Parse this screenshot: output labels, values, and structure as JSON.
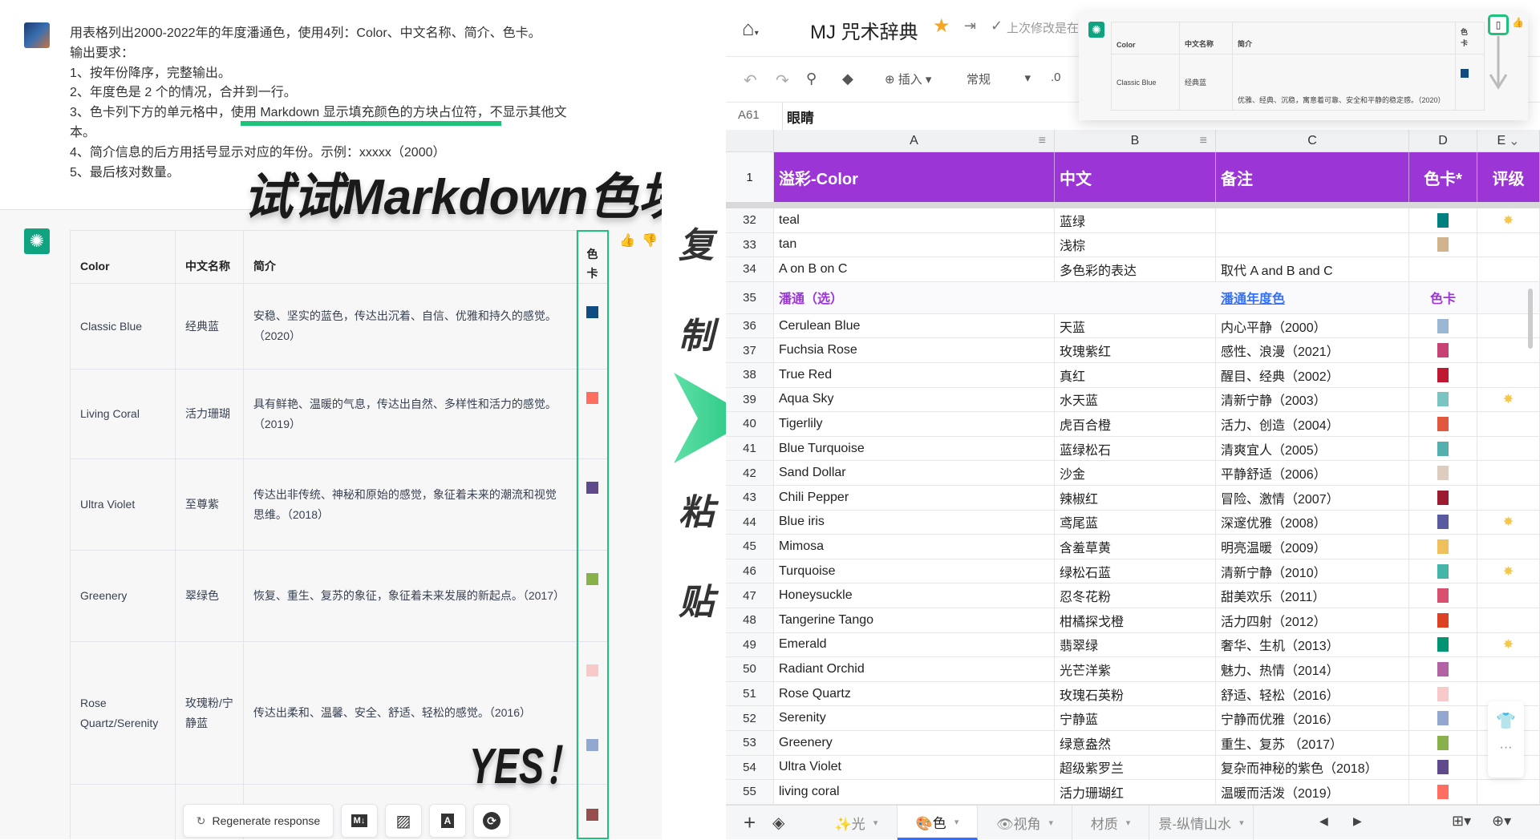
{
  "prompt": {
    "lines": [
      "用表格列出2000-2022年的年度潘通色，使用4列：Color、中文名称、简介、色卡。",
      "输出要求：",
      "1、按年份降序，完整输出。",
      "2、年度色是 2 个的情况，合并到一行。",
      "3、色卡列下方的单元格中，使用 Markdown 显示填充颜色的方块占位符，不显示其他文",
      "本。",
      "4、简介信息的后方用括号显示对应的年份。示例：xxxxx（2000）",
      "5、最后核对数量。"
    ]
  },
  "captions": {
    "title": "试试Markdown色块",
    "yes": "YES！",
    "vertical": [
      "复",
      "制",
      "粘",
      "贴"
    ]
  },
  "chat_table": {
    "headers": [
      "Color",
      "中文名称",
      "简介",
      "色卡"
    ],
    "rows": [
      {
        "color": "Classic Blue",
        "cn": "经典蓝",
        "desc": "安稳、坚实的蓝色，传达出沉着、自信、优雅和持久的感觉。（2020）",
        "swatch": "#0f4c81"
      },
      {
        "color": "Living Coral",
        "cn": "活力珊瑚",
        "desc": "具有鲜艳、温暖的气息，传达出自然、多样性和活力的感觉。（2019）",
        "swatch": "#ff6f61"
      },
      {
        "color": "Ultra Violet",
        "cn": "至尊紫",
        "desc": "传达出非传统、神秘和原始的感觉，象征着未来的潮流和视觉思维。（2018）",
        "swatch": "#5f4b8b"
      },
      {
        "color": "Greenery",
        "cn": "翠绿色",
        "desc": "恢复、重生、复苏的象征，象征着未来发展的新起点。（2017）",
        "swatch": "#88b04b"
      },
      {
        "color": "Rose Quartz/Serenity",
        "cn": "玫瑰粉/宁静蓝",
        "desc": "传达出柔和、温馨、安全、舒适、轻松的感觉。（2016）",
        "swatch": "#f7cac9",
        "swatch2": "#92a8d1"
      }
    ],
    "partial_swatch": "#964f4c"
  },
  "chat_actions": {
    "regenerate": "Regenerate response",
    "icons": [
      "markdown-icon",
      "image-icon",
      "pdf-icon",
      "sync-icon"
    ]
  },
  "sheet": {
    "title": "MJ 咒术辞典",
    "last_modified": "上次修改是在",
    "toolbar": {
      "insert": "插入",
      "format": "常规",
      "decimal": ".0"
    },
    "cell_ref": "A61",
    "formula": "眼睛",
    "columns": [
      "A",
      "B",
      "C",
      "D",
      "E"
    ],
    "header_row": {
      "num": "1",
      "cells": [
        "溢彩-Color",
        "中文",
        "备注",
        "色卡*",
        "评级"
      ]
    },
    "header_color": "#9b35d6",
    "rows": [
      {
        "n": "32",
        "a": "teal",
        "b": "蓝绿",
        "c": "",
        "sw": "#00807f",
        "star": true
      },
      {
        "n": "33",
        "a": "tan",
        "b": "浅棕",
        "c": "",
        "sw": "#d2b48c"
      },
      {
        "n": "34",
        "a": "A on B on C",
        "b": "多色彩的表达",
        "c": "取代 A and B and C",
        "sw": ""
      },
      {
        "n": "35",
        "a": "潘通（选）",
        "b": "",
        "c": "潘通年度色",
        "d": "色卡",
        "section": true
      },
      {
        "n": "36",
        "a": "Cerulean Blue",
        "b": "天蓝",
        "c": "内心平静（2000）",
        "sw": "#9bb7d4"
      },
      {
        "n": "37",
        "a": "Fuchsia Rose",
        "b": "玫瑰紫红",
        "c": "感性、浪漫（2021）",
        "sw": "#c74375"
      },
      {
        "n": "38",
        "a": "True Red",
        "b": "真红",
        "c": "醒目、经典（2002）",
        "sw": "#bf1932"
      },
      {
        "n": "39",
        "a": "Aqua Sky",
        "b": "水天蓝",
        "c": "清新宁静（2003）",
        "sw": "#7bc4c4",
        "star": true
      },
      {
        "n": "40",
        "a": "Tigerlily",
        "b": "虎百合橙",
        "c": "活力、创造（2004）",
        "sw": "#e2583e"
      },
      {
        "n": "41",
        "a": "Blue Turquoise",
        "b": "蓝绿松石",
        "c": "清爽宜人（2005）",
        "sw": "#53b0ae"
      },
      {
        "n": "42",
        "a": "Sand Dollar",
        "b": "沙金",
        "c": "平静舒适（2006）",
        "sw": "#decdbe"
      },
      {
        "n": "43",
        "a": "Chili Pepper",
        "b": "辣椒红",
        "c": "冒险、激情（2007）",
        "sw": "#9b1b30"
      },
      {
        "n": "44",
        "a": "Blue iris",
        "b": "鸢尾蓝",
        "c": "深邃优雅（2008）",
        "sw": "#5a5b9f",
        "star": true
      },
      {
        "n": "45",
        "a": "Mimosa",
        "b": "含羞草黄",
        "c": "明亮温暖（2009）",
        "sw": "#f0c05a"
      },
      {
        "n": "46",
        "a": "Turquoise",
        "b": "绿松石蓝",
        "c": "清新宁静（2010）",
        "sw": "#45b5aa",
        "star": true
      },
      {
        "n": "47",
        "a": "Honeysuckle",
        "b": "忍冬花粉",
        "c": "甜美欢乐（2011）",
        "sw": "#d94f70"
      },
      {
        "n": "48",
        "a": "Tangerine Tango",
        "b": "柑橘探戈橙",
        "c": "活力四射（2012）",
        "sw": "#dd4124"
      },
      {
        "n": "49",
        "a": "Emerald",
        "b": "翡翠绿",
        "c": "奢华、生机（2013）",
        "sw": "#009473",
        "star": true
      },
      {
        "n": "50",
        "a": "Radiant Orchid",
        "b": "光芒洋紫",
        "c": "魅力、热情（2014）",
        "sw": "#b163a3"
      },
      {
        "n": "51",
        "a": "Rose Quartz",
        "b": "玫瑰石英粉",
        "c": "舒适、轻松（2016）",
        "sw": "#f7cac9"
      },
      {
        "n": "52",
        "a": "Serenity",
        "b": "宁静蓝",
        "c": "宁静而优雅（2016）",
        "sw": "#92a8d1"
      },
      {
        "n": "53",
        "a": "Greenery",
        "b": "绿意盎然",
        "c": "重生、复苏 （2017）",
        "sw": "#88b04b"
      },
      {
        "n": "54",
        "a": "Ultra Violet",
        "b": "超级紫罗兰",
        "c": "复杂而神秘的紫色（2018）",
        "sw": "#5f4b8b"
      },
      {
        "n": "55",
        "a": "living coral",
        "b": "活力珊瑚红",
        "c": "温暖而活泼（2019）",
        "sw": "#ff6f61"
      }
    ],
    "tabs": [
      {
        "label": "✨光"
      },
      {
        "label": "🎨色",
        "active": true
      },
      {
        "label": "👁视角"
      },
      {
        "label": "材质"
      },
      {
        "label": "景-纵情山水"
      }
    ]
  },
  "popup": {
    "headers": [
      "Color",
      "中文名称",
      "简介",
      "色卡"
    ],
    "row": {
      "color": "Classic Blue",
      "cn": "经典蓝",
      "desc": "优雅、经典、沉稳，寓意着可靠、安全和平静的稳定感。（2020）",
      "swatch": "#0f4c81"
    }
  },
  "accent": "#1ec27b"
}
